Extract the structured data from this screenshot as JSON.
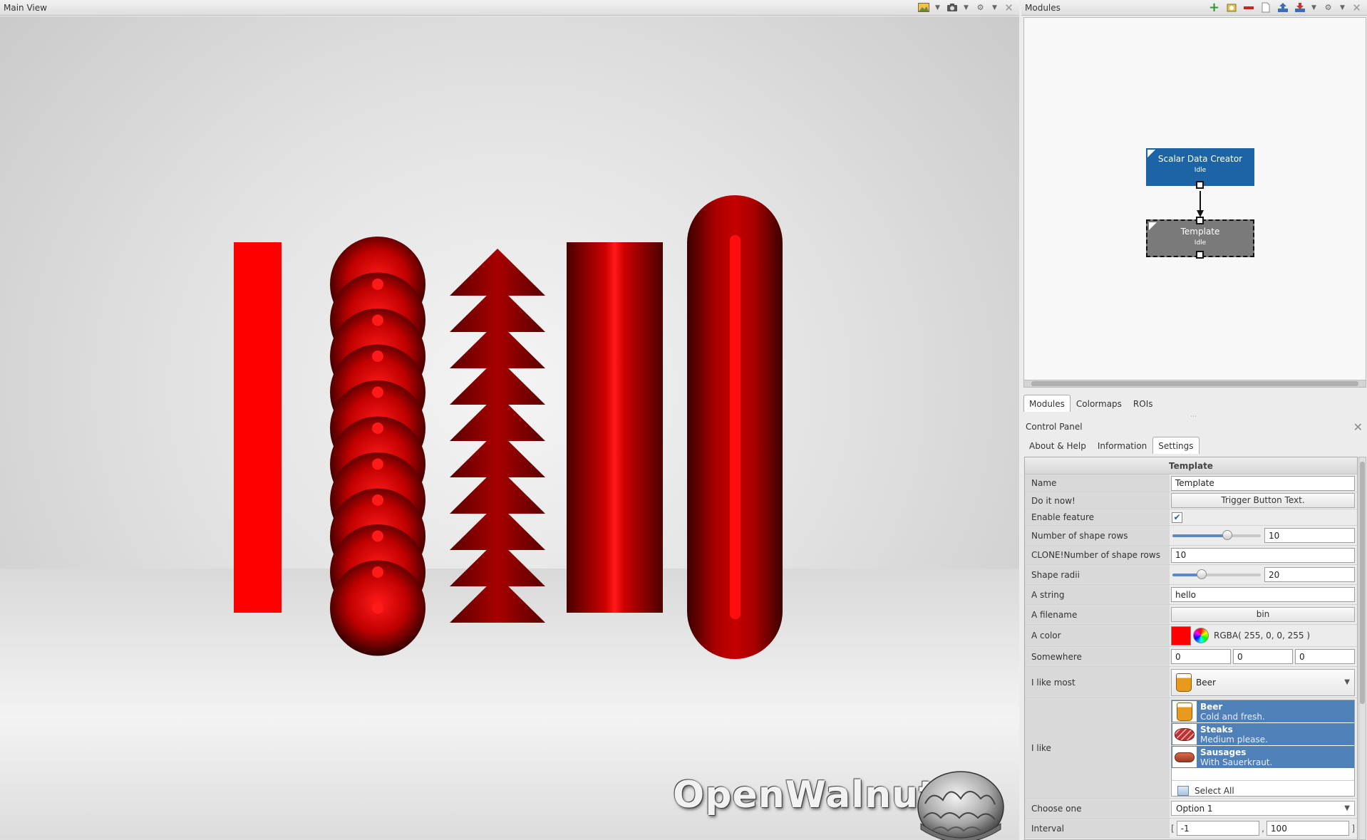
{
  "main_view": {
    "title": "Main View",
    "logo_text": "OpenWalnut"
  },
  "modules_panel": {
    "title": "Modules",
    "nodes": [
      {
        "title": "Scalar Data Creator",
        "status": "Idle"
      },
      {
        "title": "Template",
        "status": "Idle"
      }
    ],
    "tabs": [
      "Modules",
      "Colormaps",
      "ROIs"
    ]
  },
  "control_panel": {
    "title": "Control Panel",
    "tabs": [
      "About & Help",
      "Information",
      "Settings"
    ],
    "group": "Template",
    "name": {
      "label": "Name",
      "value": "Template"
    },
    "do_it_now": {
      "label": "Do it now!",
      "button": "Trigger Button Text."
    },
    "enable_feature": {
      "label": "Enable feature",
      "checked": true
    },
    "shape_rows": {
      "label": "Number of shape rows",
      "value": "10",
      "fraction": 0.62
    },
    "clone_rows": {
      "label": "CLONE!Number of shape rows",
      "value": "10"
    },
    "shape_radii": {
      "label": "Shape radii",
      "value": "20",
      "fraction": 0.33
    },
    "a_string": {
      "label": "A string",
      "value": "hello"
    },
    "a_filename": {
      "label": "A filename",
      "value": "bin"
    },
    "a_color": {
      "label": "A color",
      "text": "RGBA( 255, 0, 0, 255 )",
      "hex": "#ff0000"
    },
    "somewhere": {
      "label": "Somewhere",
      "x": "0",
      "y": "0",
      "z": "0"
    },
    "i_like_most": {
      "label": "I like most",
      "value": "Beer"
    },
    "i_like": {
      "label": "I like",
      "items": [
        {
          "name": "Beer",
          "desc": "Cold and fresh."
        },
        {
          "name": "Steaks",
          "desc": "Medium please."
        },
        {
          "name": "Sausages",
          "desc": "With Sauerkraut."
        }
      ],
      "select_all": "Select All"
    },
    "choose_one": {
      "label": "Choose one",
      "value": "Option 1"
    },
    "interval": {
      "label": "Interval",
      "min": "-1",
      "max": "100"
    }
  },
  "icons": [
    "picture-icon",
    "camera-icon",
    "gear-icon",
    "close-icon",
    "add-module-icon",
    "roi-icon",
    "remove-icon",
    "new-file-icon",
    "load-icon",
    "save-icon"
  ],
  "colors": {
    "shape_red": "#ff0000",
    "node_blue": "#1d64a7",
    "node_gray": "#7a7a7a",
    "selection": "#4f80b8"
  }
}
